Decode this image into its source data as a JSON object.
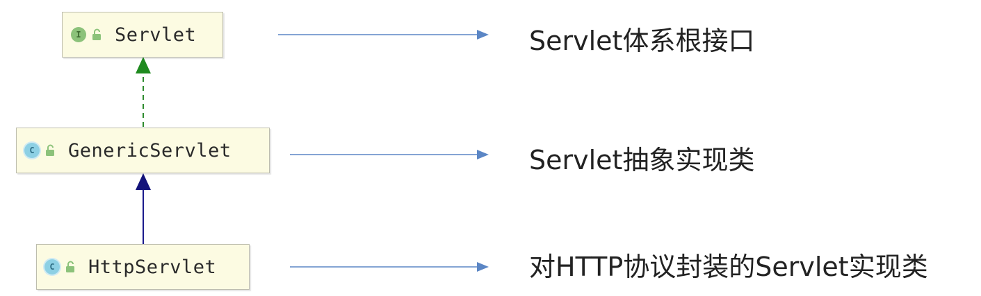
{
  "nodes": [
    {
      "id": "servlet",
      "badge": "I",
      "kind": "interface",
      "name": "Servlet"
    },
    {
      "id": "generic",
      "badge": "C",
      "kind": "class",
      "name": "GenericServlet"
    },
    {
      "id": "http",
      "badge": "C",
      "kind": "class",
      "name": "HttpServlet"
    }
  ],
  "descriptions": [
    "Servlet体系根接口",
    "Servlet抽象实现类",
    "对HTTP协议封装的Servlet实现类"
  ],
  "colors": {
    "implements_edge": "#2e8b2e",
    "extends_edge": "#1a1a8c",
    "pointer_arrow": "#5b86c5",
    "node_fill": "#fcfbe2"
  }
}
